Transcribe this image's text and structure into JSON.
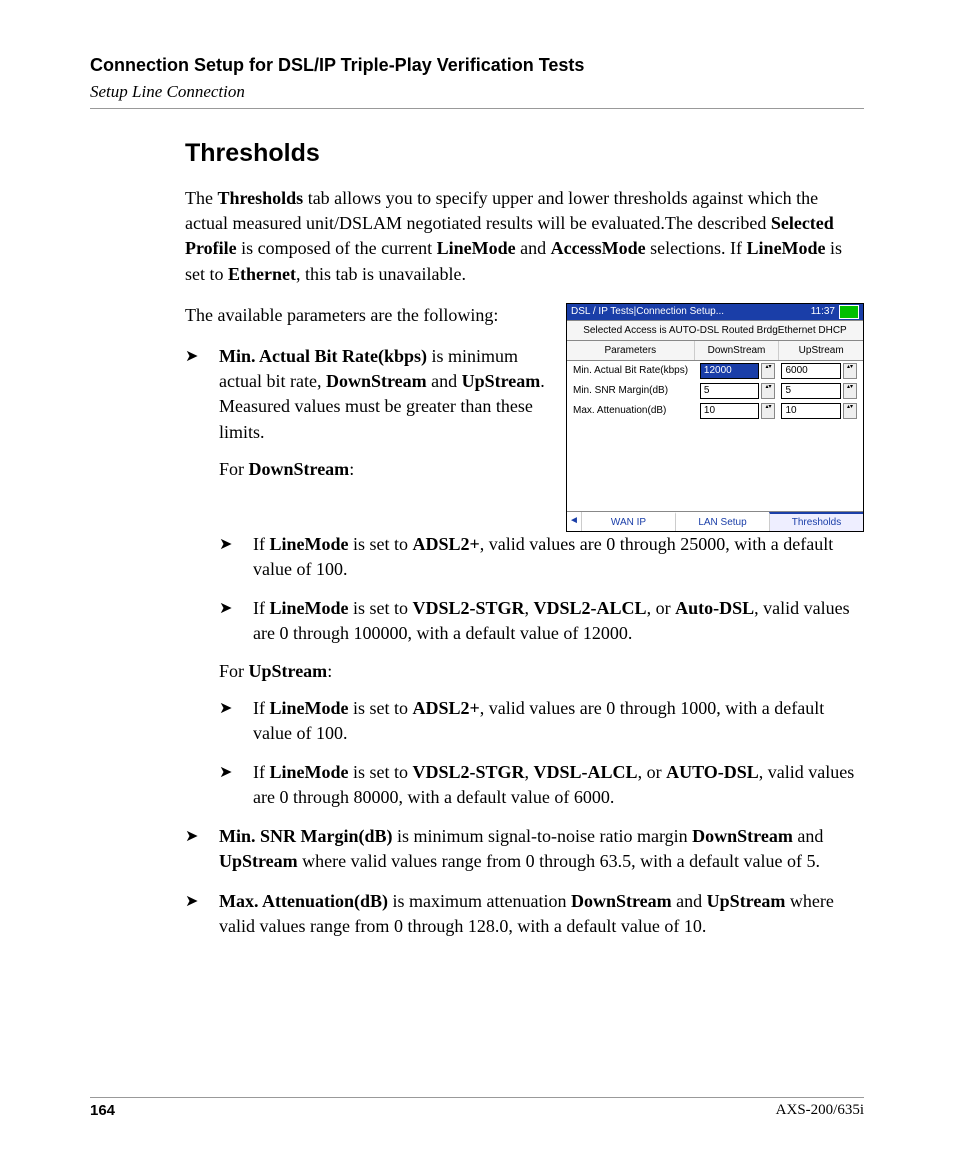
{
  "header": {
    "title": "Connection Setup for DSL/IP Triple-Play Verification Tests",
    "subtitle": "Setup Line Connection"
  },
  "section_title": "Thresholds",
  "intro": {
    "p1a": "The ",
    "p1b": "Thresholds",
    "p1c": " tab allows you to specify upper and lower thresholds against which the actual measured unit/DSLAM negotiated results will be evaluated.The described ",
    "p1d": "Selected Profile",
    "p1e": " is composed of the current ",
    "p1f": "LineMode",
    "p1g": " and ",
    "p1h": "AccessMode",
    "p1i": " selections. If ",
    "p1j": "LineMode",
    "p1k": " is set to ",
    "p1l": "Ethernet",
    "p1m": ", this tab is unavailable.",
    "p2": "The available parameters are the following:"
  },
  "b1": {
    "a": "Min. Actual Bit Rate(kbps)",
    "b": " is minimum actual bit rate, ",
    "c": "DownStream",
    "d": " and ",
    "e": "UpStream",
    "f": ". Measured values must be greater than these limits."
  },
  "for_down": "For ",
  "for_down_b": "DownStream",
  "for_down_c": ":",
  "ds1": {
    "a": "If ",
    "b": "LineMode",
    "c": " is set to ",
    "d": "ADSL2+",
    "e": ", valid values are 0 through 25000, with a default value of 100."
  },
  "ds2": {
    "a": "If ",
    "b": "LineMode",
    "c": " is set to ",
    "d": "VDSL2-STGR",
    "e": ", ",
    "f": "VDSL2-ALCL",
    "g": ", or ",
    "h": "Auto-DSL",
    "i": ", valid values are 0 through 100000, with a default value of 12000."
  },
  "for_up": "For ",
  "for_up_b": "UpStream",
  "for_up_c": ":",
  "us1": {
    "a": "If ",
    "b": "LineMode",
    "c": " is set to ",
    "d": "ADSL2+",
    "e": ", valid values are 0 through 1000, with a default value of 100."
  },
  "us2": {
    "a": "If ",
    "b": "LineMode",
    "c": " is set to ",
    "d": "VDSL2-STGR",
    "e": ", ",
    "f": "VDSL-ALCL",
    "g": ", or ",
    "h": "AUTO-DSL",
    "i": ", valid values are 0 through 80000, with a default value of 6000."
  },
  "b2": {
    "a": "Min. SNR Margin(dB)",
    "b": " is minimum signal-to-noise ratio margin ",
    "c": "DownStream",
    "d": " and ",
    "e": "UpStream",
    "f": " where valid values range from 0 through 63.5, with a default value of 5."
  },
  "b3": {
    "a": "Max. Attenuation(dB)",
    "b": " is maximum attenuation ",
    "c": "DownStream",
    "d": " and ",
    "e": "UpStream",
    "f": " where valid values range from 0 through 128.0, with a default value of 10."
  },
  "device": {
    "title": "DSL / IP Tests|Connection Setup...",
    "time": "11:37",
    "selected": "Selected Access  is AUTO-DSL Routed BrdgEthernet DHCP",
    "col_param": "Parameters",
    "col_down": "DownStream",
    "col_up": "UpStream",
    "rows": [
      {
        "label": "Min. Actual Bit Rate(kbps)",
        "down": "12000",
        "up": "6000",
        "sel": true
      },
      {
        "label": "Min. SNR Margin(dB)",
        "down": "5",
        "up": "5",
        "sel": false
      },
      {
        "label": "Max. Attenuation(dB)",
        "down": "10",
        "up": "10",
        "sel": false
      }
    ],
    "tabs": {
      "nav": "◄",
      "t1": "WAN IP",
      "t2": "LAN Setup",
      "t3": "Thresholds"
    }
  },
  "footer": {
    "page": "164",
    "doc": "AXS-200/635i"
  }
}
